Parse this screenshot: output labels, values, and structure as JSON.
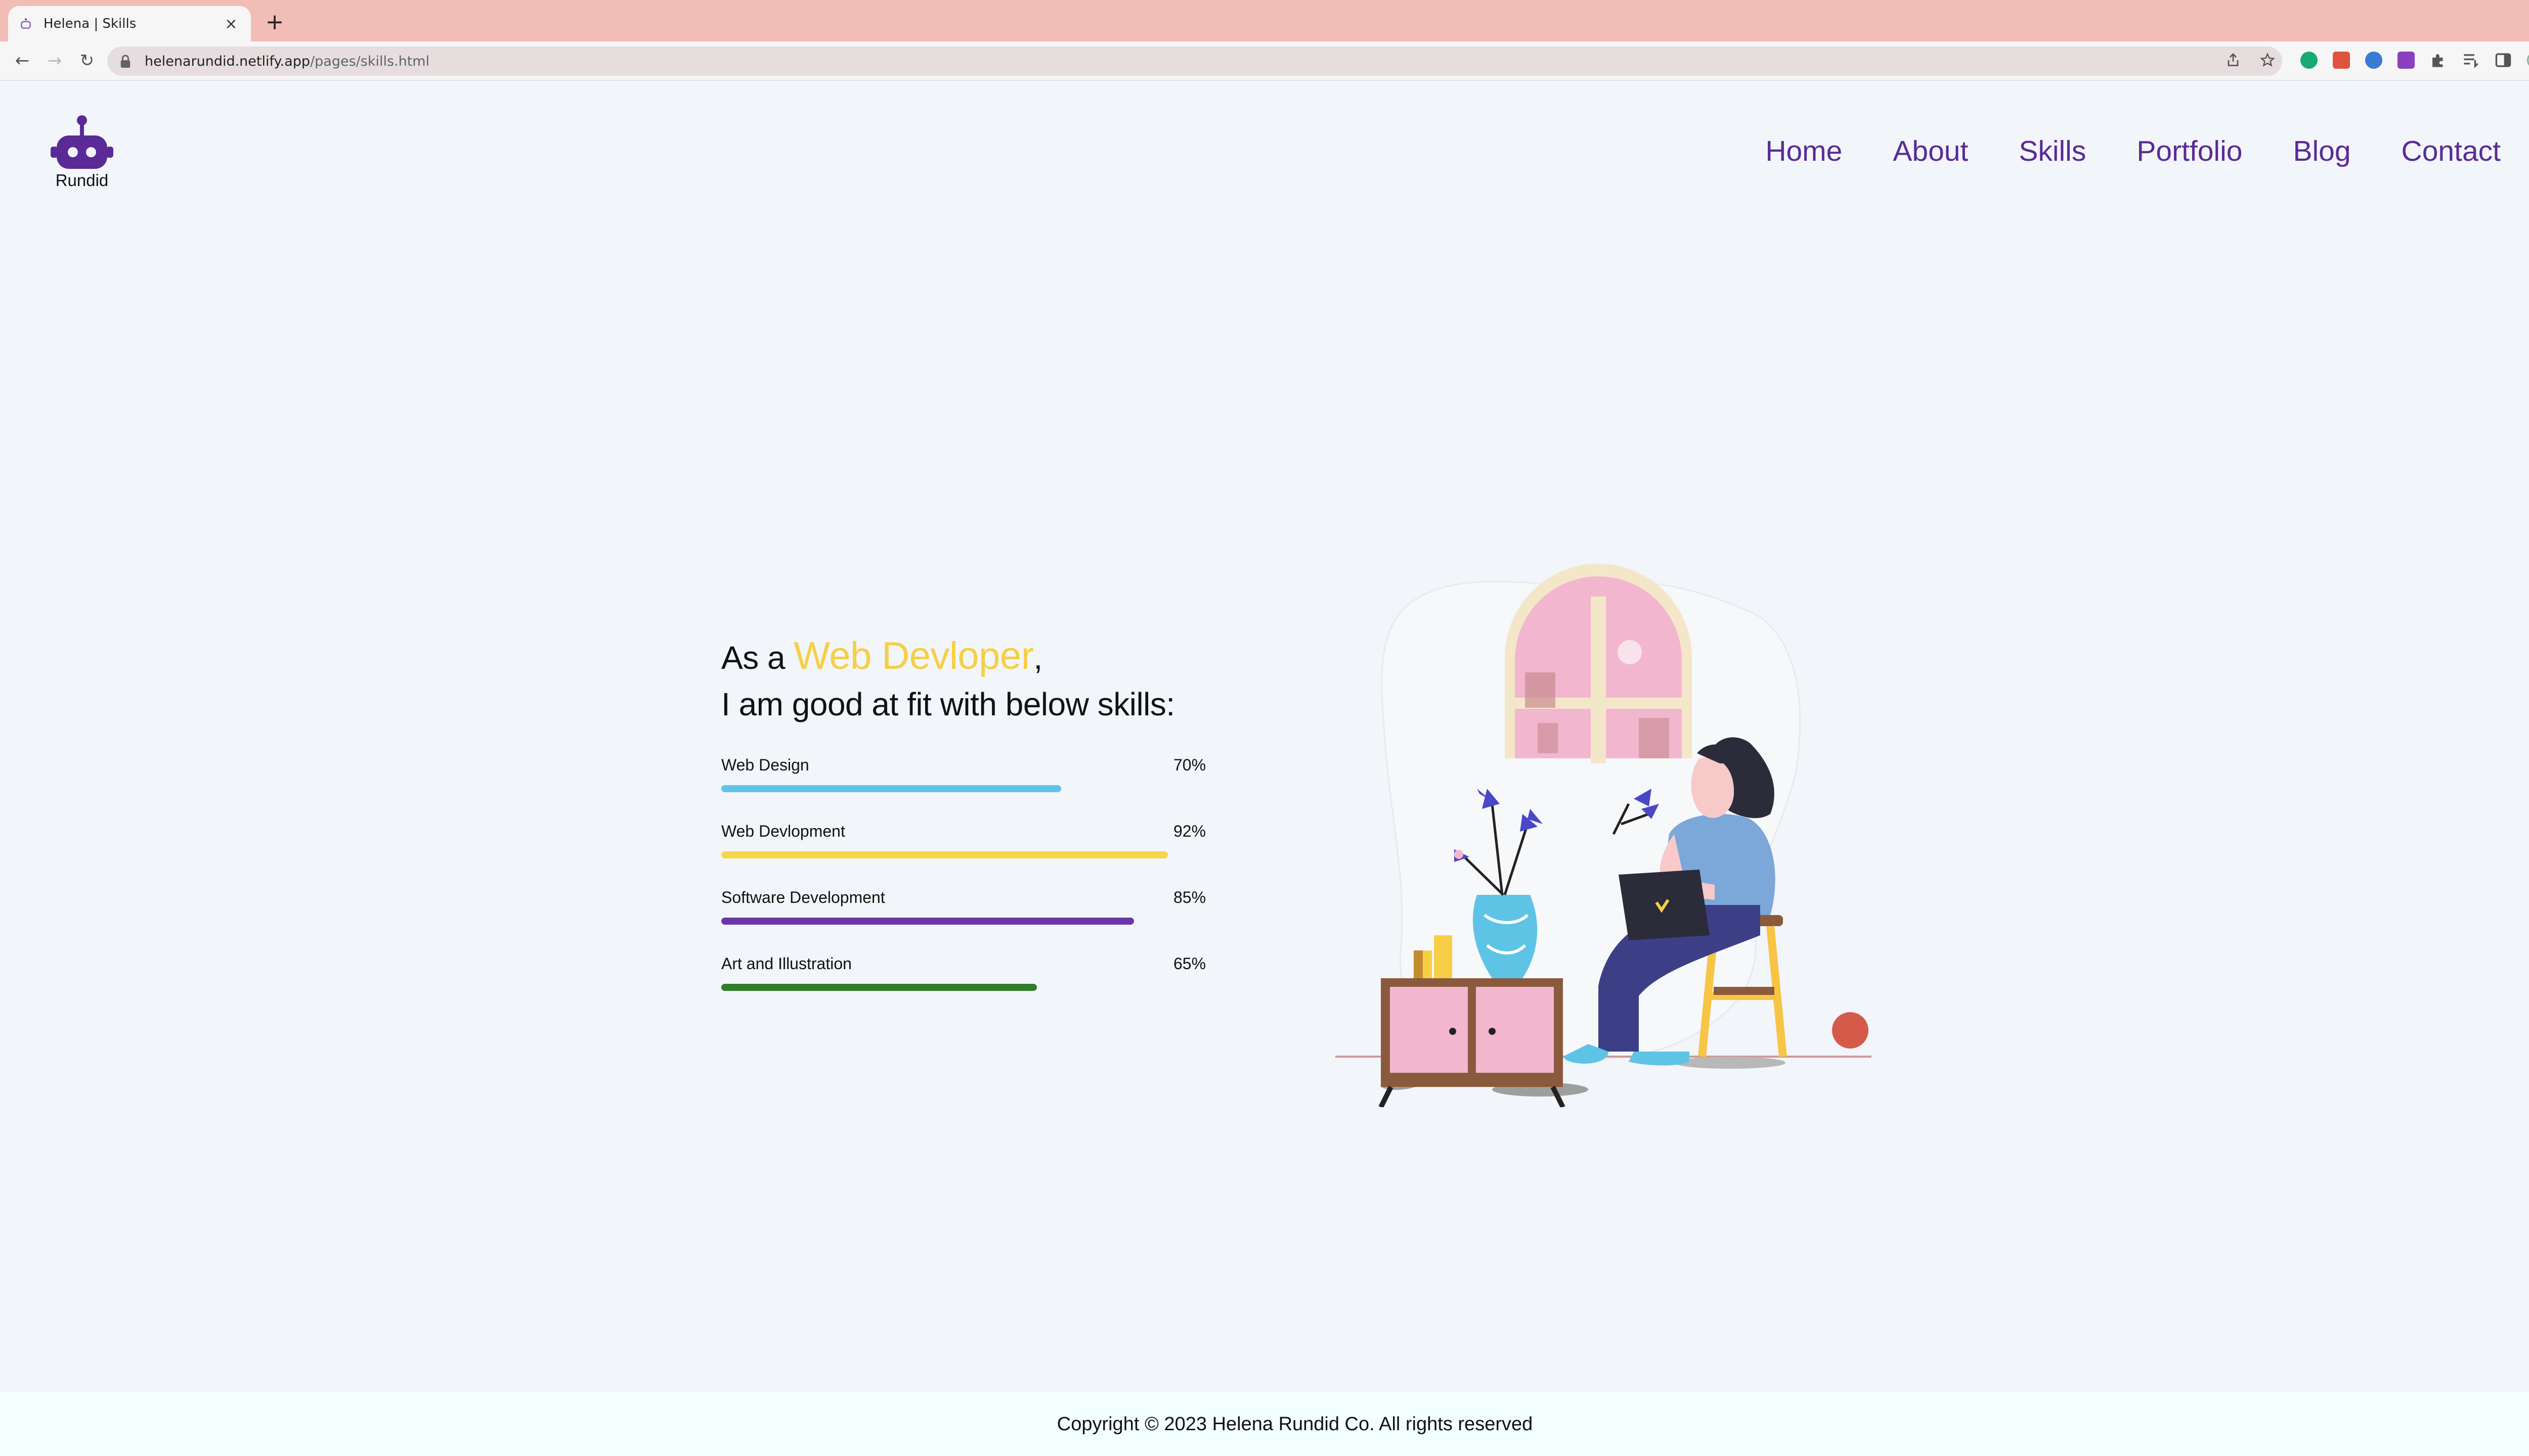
{
  "browser": {
    "tab_title": "Helena | Skills",
    "close_glyph": "×",
    "newtab_glyph": "+",
    "url_host": "helenarundid.netlify.app",
    "url_path": "/pages/skills.html",
    "back_glyph": "←",
    "forward_glyph": "→",
    "reload_glyph": "↻",
    "icons": [
      "share-icon",
      "star-icon",
      "grammarly-extension-icon",
      "pdf-extension-icon",
      "blue-extension-icon",
      "purple-extension-icon",
      "puzzle-extension-icon",
      "reading-list-icon",
      "sidepanel-icon",
      "profile-icon",
      "menu-icon"
    ]
  },
  "site": {
    "logo_text": "Rundid",
    "nav": [
      "Home",
      "About",
      "Skills",
      "Portfolio",
      "Blog",
      "Contact"
    ],
    "colors": {
      "nav": "#5a2a97",
      "accent": "#f6cf45"
    }
  },
  "hero": {
    "line1_prefix": "As a ",
    "line1_accent": "Web Devloper",
    "line1_suffix": ",",
    "line2": "I am good at fit with below skills:"
  },
  "skills": [
    {
      "name": "Web Design",
      "percent_label": "70%",
      "level": 0.7,
      "color": "#5ec4e6"
    },
    {
      "name": "Web Devlopment",
      "percent_label": "92%",
      "level": 0.92,
      "color": "#f6d54a"
    },
    {
      "name": "Software Development",
      "percent_label": "85%",
      "level": 0.85,
      "color": "#6a37a8"
    },
    {
      "name": "Art and Illustration",
      "percent_label": "65%",
      "level": 0.65,
      "color": "#2f7d27"
    }
  ],
  "footer": {
    "copyright": "Copyright © 2023 Helena Rundid Co. All rights reserved"
  }
}
